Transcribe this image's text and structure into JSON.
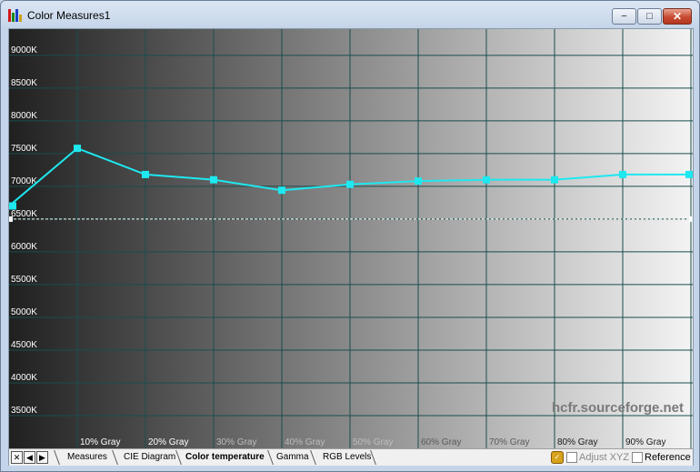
{
  "window": {
    "title": "Color Measures1",
    "controls": {
      "minimize": "−",
      "maximize": "□",
      "close": "✕"
    }
  },
  "chart_data": {
    "type": "line",
    "y_tick_labels": [
      "3500K",
      "4000K",
      "4500K",
      "5000K",
      "5500K",
      "6000K",
      "6500K",
      "7000K",
      "7500K",
      "8000K",
      "8500K",
      "9000K"
    ],
    "y_ticks": [
      3500,
      4000,
      4500,
      5000,
      5500,
      6000,
      6500,
      7000,
      7500,
      8000,
      8500,
      9000
    ],
    "ylim": [
      3000,
      9400
    ],
    "x_tick_labels": [
      "10% Gray",
      "20% Gray",
      "30% Gray",
      "40% Gray",
      "50% Gray",
      "60% Gray",
      "70% Gray",
      "80% Gray",
      "90% Gray"
    ],
    "x": [
      0,
      10,
      20,
      30,
      40,
      50,
      60,
      70,
      80,
      90,
      100
    ],
    "xlim": [
      0,
      100
    ],
    "series": [
      {
        "values": [
          6700,
          7580,
          7180,
          7100,
          6940,
          7030,
          7080,
          7100,
          7100,
          7180,
          7180
        ],
        "color": "#1ee8f0"
      }
    ],
    "reference_value": 6500,
    "watermark": "hcfr.sourceforge.net",
    "grid": true,
    "grid_color": "#1b4d4d"
  },
  "tabs": {
    "nav": {
      "close": "✕",
      "prev": "◀",
      "next": "▶"
    },
    "items": [
      "Measures",
      "CIE Diagram",
      "Color temperature",
      "Gamma",
      "RGB Levels"
    ],
    "active_index": 2
  },
  "options": {
    "adjust_xyz": {
      "label": "Adjust XYZ",
      "checked": false,
      "enabled": false
    },
    "reference": {
      "label": "Reference",
      "checked": false,
      "enabled": true
    }
  }
}
